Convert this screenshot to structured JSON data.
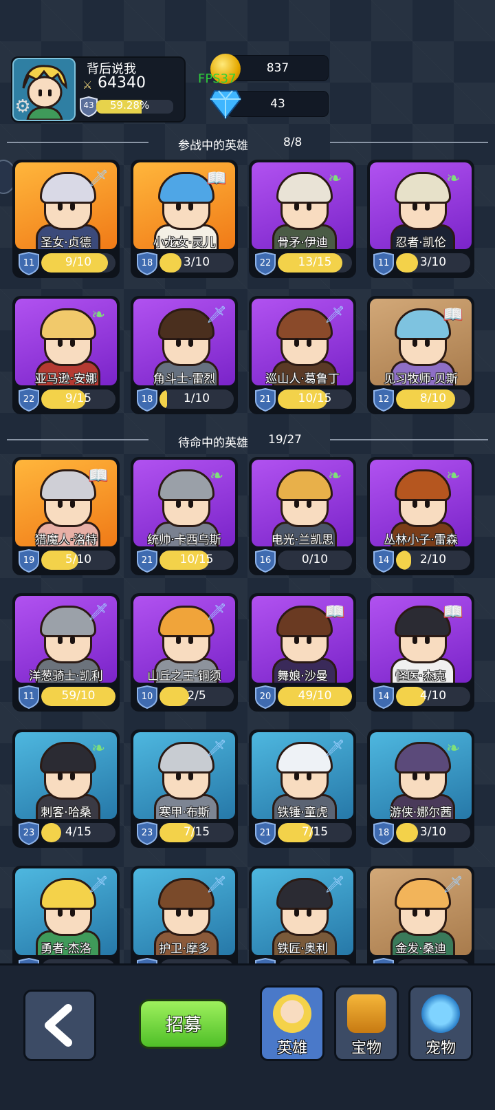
{
  "player": {
    "name": "背后说我",
    "power": "64340",
    "level": "43",
    "xp_percent": "59.28%",
    "xp_fraction": 0.5928
  },
  "resources": {
    "coins": "837",
    "gems": "43"
  },
  "fps": "FPS37",
  "sections": {
    "active": {
      "title": "参战中的英雄",
      "count": "8/8"
    },
    "reserve": {
      "title": "待命中的英雄",
      "count": "19/27"
    }
  },
  "colors": {
    "accent_yellow": "#f3d24a",
    "recruit_green": "#5fcf30",
    "active_tab": "#4a79c9"
  },
  "heroes": [
    {
      "name": "圣女·贞德",
      "level": "11",
      "progress": "9/10",
      "fill": 0.9,
      "bg": "orange",
      "class": "sword-icon",
      "hair": "#d9d9e6",
      "body": "#3b4a7a"
    },
    {
      "name": "小龙女·灵儿",
      "level": "18",
      "progress": "3/10",
      "fill": 0.3,
      "bg": "orange",
      "class": "book-icon",
      "hair": "#4fa6e6",
      "body": "#f4f0e6"
    },
    {
      "name": "骨矛·伊迪",
      "level": "22",
      "progress": "13/15",
      "fill": 0.87,
      "bg": "purple",
      "class": "wing-icon",
      "hair": "#e9e3d6",
      "body": "#4a5b45"
    },
    {
      "name": "忍者·凯伦",
      "level": "11",
      "progress": "3/10",
      "fill": 0.3,
      "bg": "purple",
      "class": "wing-icon",
      "hair": "#e7e1c9",
      "body": "#1b2233"
    },
    {
      "name": "亚马逊·安娜",
      "level": "22",
      "progress": "9/15",
      "fill": 0.6,
      "bg": "purple",
      "class": "wing-icon",
      "hair": "#f1c96b",
      "body": "#b53a32"
    },
    {
      "name": "角斗士·雷烈",
      "level": "18",
      "progress": "1/10",
      "fill": 0.1,
      "bg": "purple",
      "class": "sword-icon",
      "hair": "#4a2f1e",
      "body": "#667180"
    },
    {
      "name": "巡山人·葛鲁丁",
      "level": "21",
      "progress": "10/15",
      "fill": 0.67,
      "bg": "purple",
      "class": "sword-icon",
      "hair": "#8a4a2a",
      "body": "#5a3a26"
    },
    {
      "name": "见习牧师·贝斯",
      "level": "12",
      "progress": "8/10",
      "fill": 0.8,
      "bg": "tan",
      "class": "book-icon",
      "hair": "#7ec3e0",
      "body": "#8e6fc6"
    },
    {
      "name": "猎魔人·洛特",
      "level": "19",
      "progress": "5/10",
      "fill": 0.5,
      "bg": "orange",
      "class": "book-icon",
      "hair": "#cfcfd6",
      "body": "#e8b0a6"
    },
    {
      "name": "统帅·卡西乌斯",
      "level": "21",
      "progress": "10/15",
      "fill": 0.67,
      "bg": "purple",
      "class": "wing-icon",
      "hair": "#9aa0a8",
      "body": "#7a8190"
    },
    {
      "name": "电光·兰凯思",
      "level": "16",
      "progress": "0/10",
      "fill": 0.0,
      "bg": "purple",
      "class": "wing-icon",
      "hair": "#e8b04a",
      "body": "#4a5568"
    },
    {
      "name": "丛林小子·雷森",
      "level": "14",
      "progress": "2/10",
      "fill": 0.2,
      "bg": "purple",
      "class": "wing-icon",
      "hair": "#b5561f",
      "body": "#7a3d19"
    },
    {
      "name": "洋葱骑士·凯利",
      "level": "11",
      "progress": "59/10",
      "fill": 1.0,
      "bg": "purple",
      "class": "sword-icon",
      "hair": "#9ba1a9",
      "body": "#6c737c"
    },
    {
      "name": "山丘之王·铜须",
      "level": "10",
      "progress": "2/5",
      "fill": 0.4,
      "bg": "purple",
      "class": "sword-icon",
      "hair": "#f0a43a",
      "body": "#8d939c"
    },
    {
      "name": "舞娘·沙曼",
      "level": "20",
      "progress": "49/10",
      "fill": 1.0,
      "bg": "purple",
      "class": "book-icon",
      "hair": "#6a3a22",
      "body": "#3a2a5a"
    },
    {
      "name": "怪医·杰克",
      "level": "14",
      "progress": "4/10",
      "fill": 0.4,
      "bg": "purple",
      "class": "book-icon",
      "hair": "#2b2b33",
      "body": "#f0f0f0"
    },
    {
      "name": "刺客·哈桑",
      "level": "23",
      "progress": "4/15",
      "fill": 0.27,
      "bg": "blue",
      "class": "wing-icon",
      "hair": "#2b2b33",
      "body": "#3a3a44"
    },
    {
      "name": "寒甲·布斯",
      "level": "23",
      "progress": "7/15",
      "fill": 0.47,
      "bg": "blue",
      "class": "sword-icon",
      "hair": "#c8ccd2",
      "body": "#7d8593"
    },
    {
      "name": "铁锤·童虎",
      "level": "21",
      "progress": "7/15",
      "fill": 0.47,
      "bg": "blue",
      "class": "sword-icon",
      "hair": "#eef2f6",
      "body": "#5b6473"
    },
    {
      "name": "游侠·娜尔茜",
      "level": "18",
      "progress": "3/10",
      "fill": 0.3,
      "bg": "blue",
      "class": "wing-icon",
      "hair": "#5b4a7a",
      "body": "#4a3a5a"
    },
    {
      "name": "勇者·杰洛",
      "level": "",
      "progress": "",
      "fill": 0.0,
      "bg": "blue",
      "class": "sword-icon",
      "hair": "#f4d24a",
      "body": "#3f9a5a"
    },
    {
      "name": "护卫·摩多",
      "level": "",
      "progress": "",
      "fill": 0.0,
      "bg": "blue",
      "class": "sword-icon",
      "hair": "#7a4a2a",
      "body": "#8b5a3a"
    },
    {
      "name": "铁匠·奥利",
      "level": "",
      "progress": "",
      "fill": 0.0,
      "bg": "blue",
      "class": "sword-icon",
      "hair": "#2b2b33",
      "body": "#7a5a3a"
    },
    {
      "name": "金发·桑迪",
      "level": "",
      "progress": "",
      "fill": 0.0,
      "bg": "tan",
      "class": "sword-icon",
      "hair": "#f2b45a",
      "body": "#3a7a5a"
    }
  ],
  "bottom_nav": {
    "back_icon": "back-arrow-icon",
    "recruit": "招募",
    "tabs": [
      {
        "label": "英雄",
        "icon": "hero-icon",
        "active": true
      },
      {
        "label": "宝物",
        "icon": "treasure-icon",
        "active": false
      },
      {
        "label": "宠物",
        "icon": "pet-icon",
        "active": false
      }
    ]
  }
}
